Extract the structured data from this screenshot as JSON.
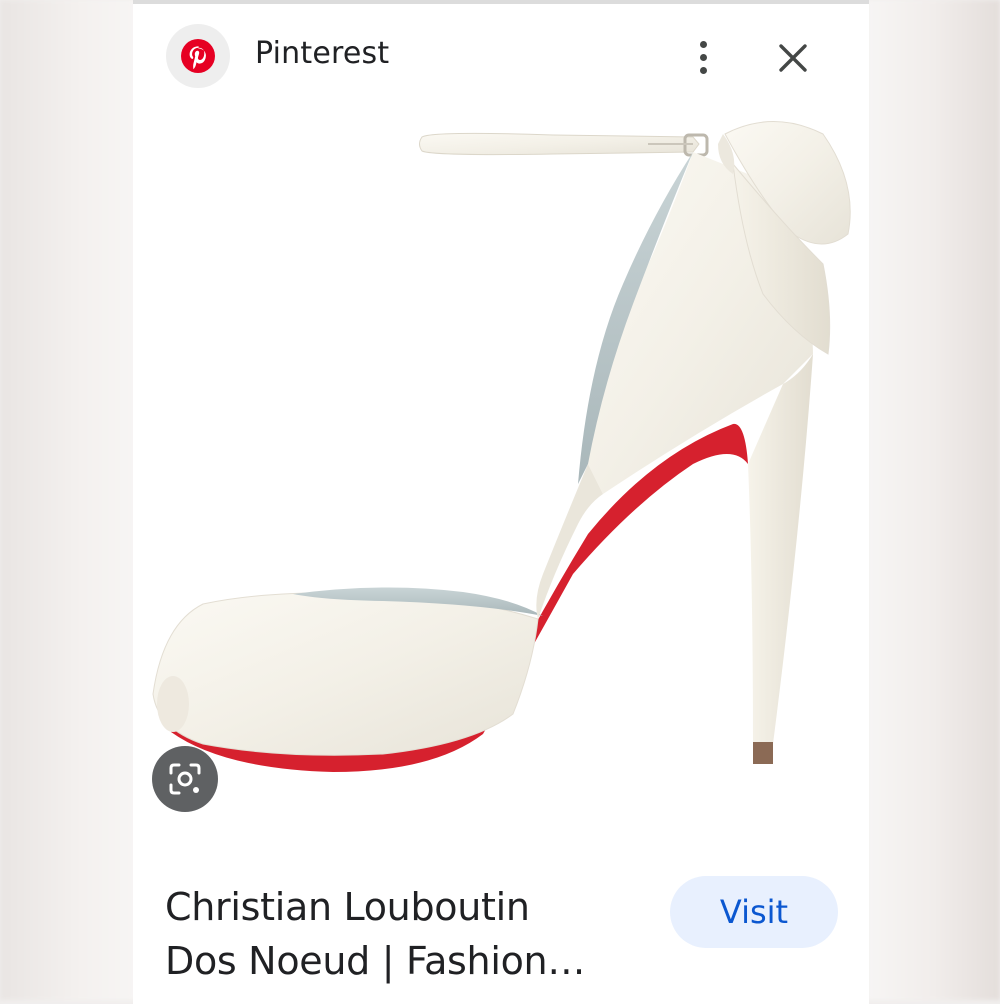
{
  "header": {
    "source_name": "Pinterest",
    "more_icon": "more-vert-icon",
    "close_icon": "close-icon"
  },
  "result": {
    "title_line1": "Christian Louboutin",
    "title_line2": "Dos Noeud | Fashion…",
    "visit_label": "Visit",
    "lens_icon": "google-lens-icon"
  },
  "colors": {
    "pinterest_red": "#e60023",
    "visit_bg": "#e8f0fe",
    "visit_text": "#0b57d0",
    "sole_red": "#d6212e"
  }
}
